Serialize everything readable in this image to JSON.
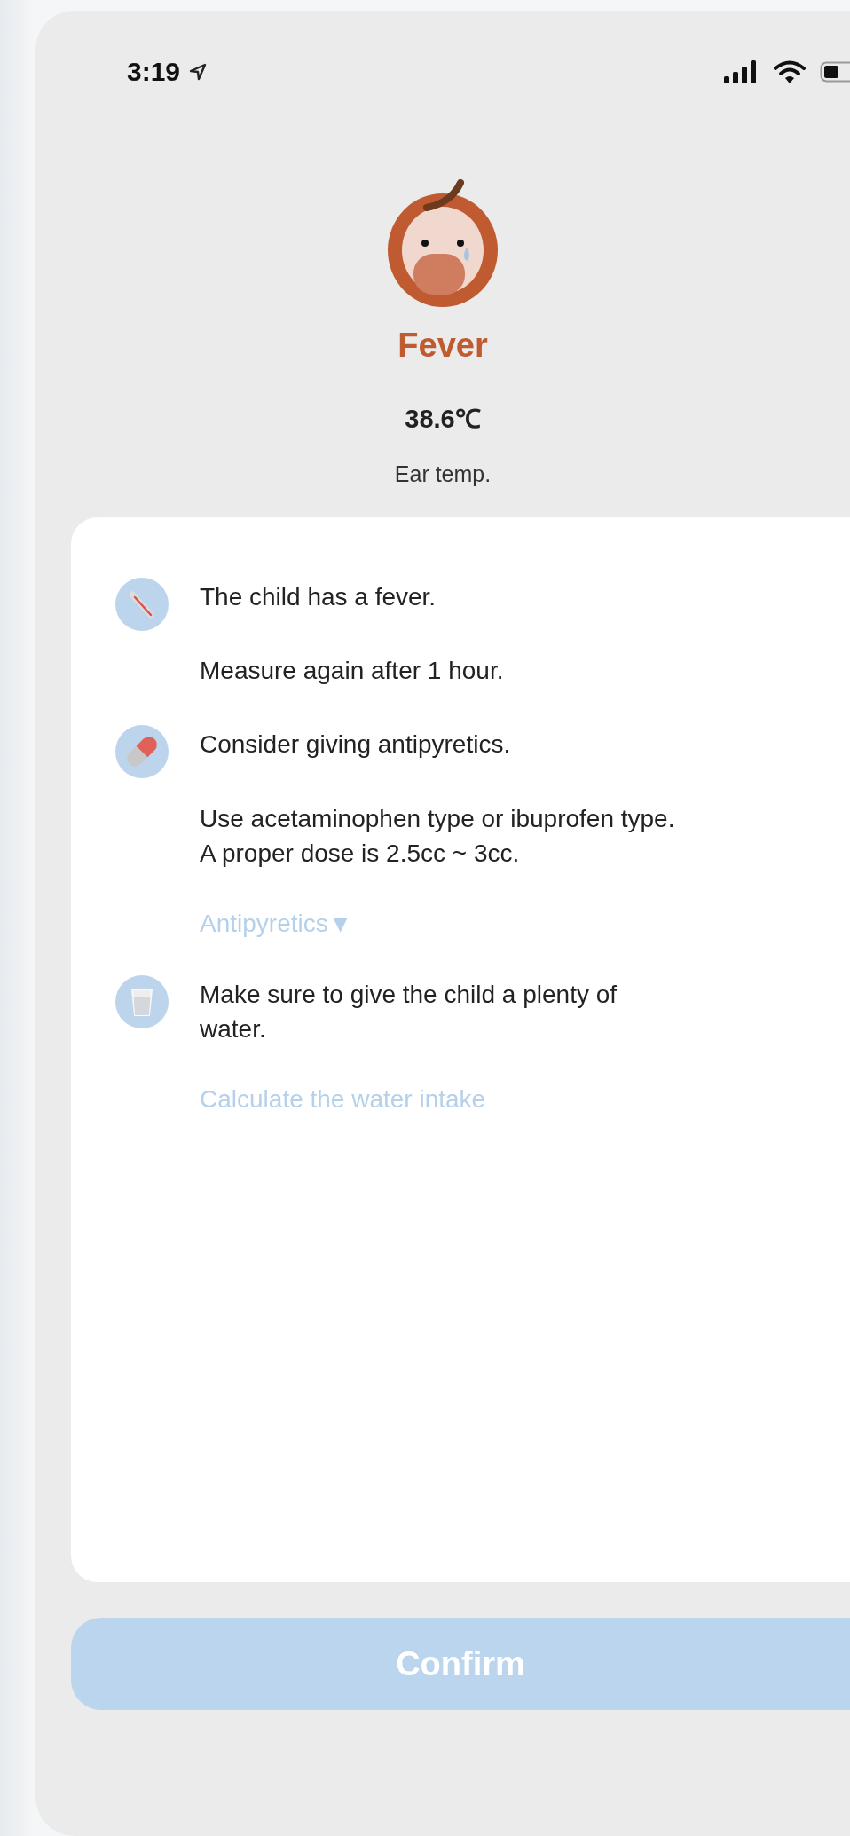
{
  "status_bar": {
    "time": "3:19"
  },
  "header": {
    "title": "Fever",
    "temperature": "38.6℃",
    "method": "Ear temp."
  },
  "advice": [
    {
      "kind": "thermometer",
      "title": "The child has a fever.",
      "notes": [
        "Measure again after 1 hour."
      ]
    },
    {
      "kind": "pill",
      "title": "Consider giving antipyretics.",
      "notes": [
        "Use acetaminophen type or ibuprofen type.",
        "A proper dose is 2.5cc ~ 3cc."
      ],
      "link": {
        "label": "Antipyretics",
        "caret": "▼"
      }
    },
    {
      "kind": "cup",
      "title": "Make sure to give the child a plenty of water.",
      "link": {
        "label": "Calculate the water intake"
      }
    }
  ],
  "confirm_button": {
    "label": "Confirm"
  }
}
